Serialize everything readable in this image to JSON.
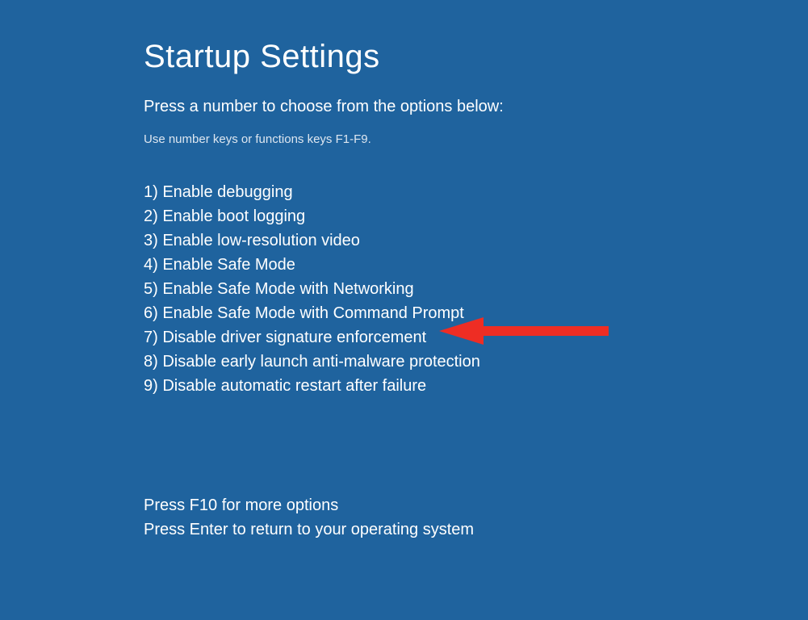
{
  "title": "Startup Settings",
  "subtitle": "Press a number to choose from the options below:",
  "hint": "Use number keys or functions keys F1-F9.",
  "options": {
    "0": "1) Enable debugging",
    "1": "2) Enable boot logging",
    "2": "3) Enable low-resolution video",
    "3": "4) Enable Safe Mode",
    "4": "5) Enable Safe Mode with Networking",
    "5": "6) Enable Safe Mode with Command Prompt",
    "6": "7) Disable driver signature enforcement",
    "7": "8) Disable early launch anti-malware protection",
    "8": "9) Disable automatic restart after failure"
  },
  "footer": {
    "line1": "Press F10 for more options",
    "line2": "Press Enter to return to your operating system"
  },
  "annotation": {
    "arrow_color": "#ee2d24",
    "points_to_option_index": 6
  }
}
